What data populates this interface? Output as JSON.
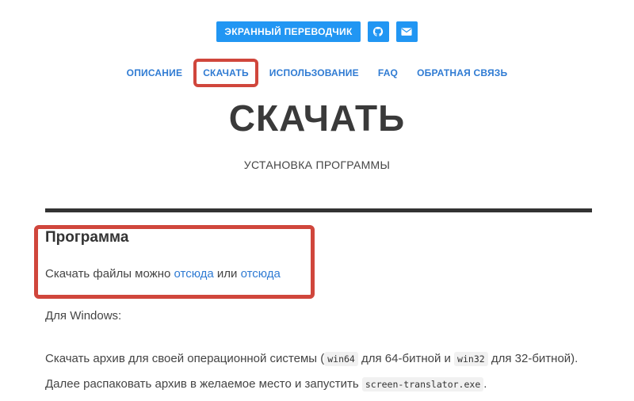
{
  "header": {
    "brand_label": "ЭКРАННЫЙ ПЕРЕВОДЧИК",
    "icons": [
      "github-icon",
      "mail-icon"
    ]
  },
  "nav": {
    "items": [
      {
        "label": "ОПИСАНИЕ",
        "active": false
      },
      {
        "label": "СКАЧАТЬ",
        "active": true
      },
      {
        "label": "ИСПОЛЬЗОВАНИЕ",
        "active": false
      },
      {
        "label": "FAQ",
        "active": false
      },
      {
        "label": "ОБРАТНАЯ СВЯЗЬ",
        "active": false
      }
    ]
  },
  "page": {
    "title": "СКАЧАТЬ",
    "subtitle": "УСТАНОВКА ПРОГРАММЫ"
  },
  "content": {
    "section_title": "Программа",
    "p1_prefix": "Скачать файлы можно ",
    "p1_link1": "отсюда",
    "p1_mid": " или ",
    "p1_link2": "отсюда",
    "p2": "Для Windows:",
    "p3_a": "Скачать архив для своей операционной системы (",
    "p3_code1": "win64",
    "p3_b": " для 64-битной и ",
    "p3_code2": "win32",
    "p3_c": " для 32-битной). Далее распаковать архив в желаемое место и запустить ",
    "p3_code3": "screen-translator.exe",
    "p3_d": "."
  },
  "colors": {
    "accent": "#2196f3",
    "link": "#2f7bd3",
    "highlight": "#d0463c"
  }
}
